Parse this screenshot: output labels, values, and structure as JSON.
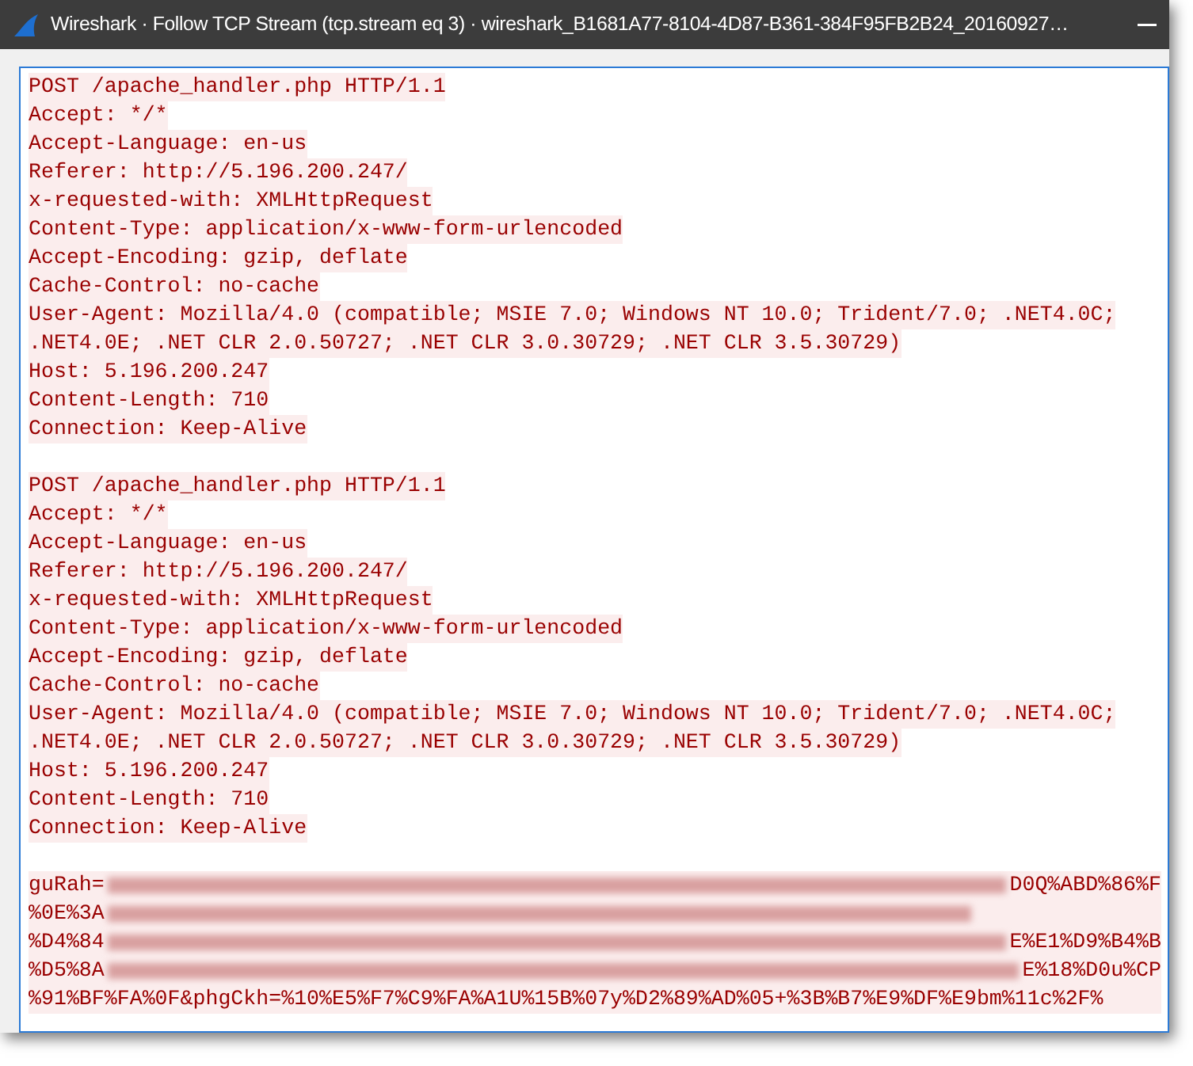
{
  "window": {
    "title": "Wireshark · Follow TCP Stream (tcp.stream eq 3) · wireshark_B1681A77-8104-4D87-B361-384F95FB2B24_20160927…"
  },
  "stream": [
    {
      "kind": "text",
      "lines": [
        "POST /apache_handler.php HTTP/1.1",
        "Accept: */*",
        "Accept-Language: en-us",
        "Referer: http://5.196.200.247/",
        "x-requested-with: XMLHttpRequest",
        "Content-Type: application/x-www-form-urlencoded",
        "Accept-Encoding: gzip, deflate",
        "Cache-Control: no-cache",
        "User-Agent: Mozilla/4.0 (compatible; MSIE 7.0; Windows NT 10.0; Trident/7.0; .NET4.0C;",
        ".NET4.0E; .NET CLR 2.0.50727; .NET CLR 3.0.30729; .NET CLR 3.5.30729)",
        "Host: 5.196.200.247",
        "Content-Length: 710",
        "Connection: Keep-Alive"
      ]
    },
    {
      "kind": "text",
      "lines": [
        "POST /apache_handler.php HTTP/1.1",
        "Accept: */*",
        "Accept-Language: en-us",
        "Referer: http://5.196.200.247/",
        "x-requested-with: XMLHttpRequest",
        "Content-Type: application/x-www-form-urlencoded",
        "Accept-Encoding: gzip, deflate",
        "Cache-Control: no-cache",
        "User-Agent: Mozilla/4.0 (compatible; MSIE 7.0; Windows NT 10.0; Trident/7.0; .NET4.0C;",
        ".NET4.0E; .NET CLR 2.0.50727; .NET CLR 3.0.30729; .NET CLR 3.5.30729)",
        "Host: 5.196.200.247",
        "Content-Length: 710",
        "Connection: Keep-Alive"
      ]
    },
    {
      "kind": "redacted",
      "lines": [
        {
          "start": "guRah=",
          "end": "D0Q%ABD%86%F"
        },
        {
          "start": "%0E%3A"
        },
        {
          "start": "%D4%84",
          "end": "E%E1%D9%B4%B"
        },
        {
          "start": "%D5%8A",
          "end": "E%18%D0u%CP"
        },
        {
          "start": "%91%BF%FA%0F&phgCkh=%10%E5%F7%C9%FA%A1U%15B%07y%D2%89%AD%05+%3B%B7%E9%DF%E9bm%11c%2F%"
        }
      ]
    }
  ]
}
